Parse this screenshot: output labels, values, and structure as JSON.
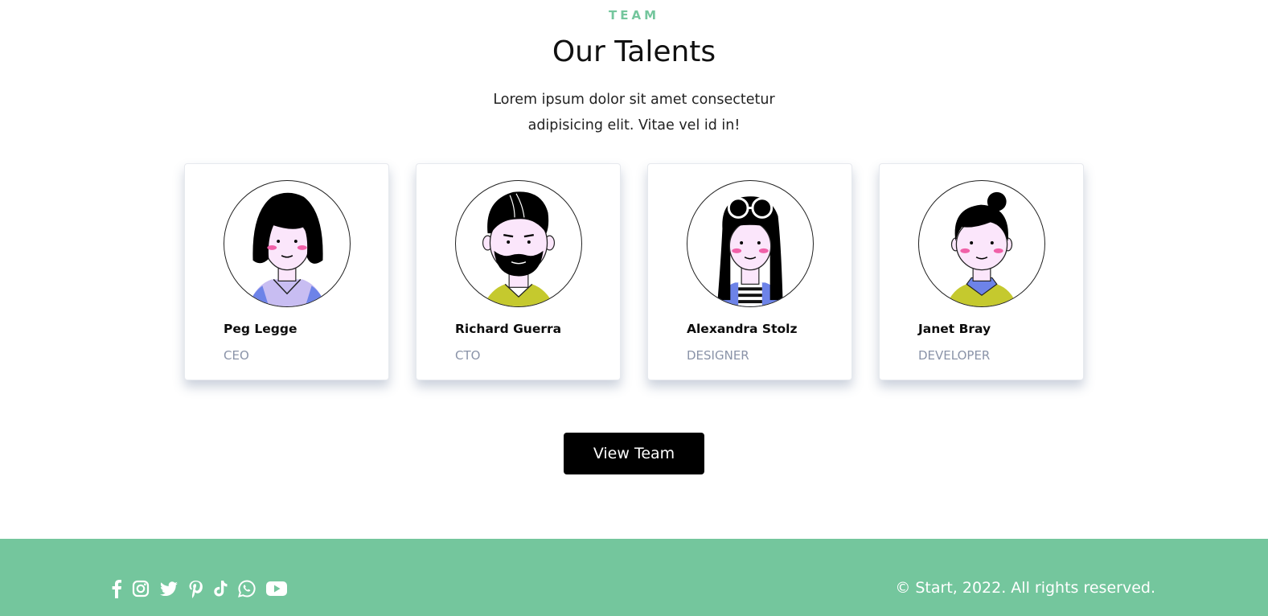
{
  "section": {
    "eyebrow": "TEAM",
    "title": "Our Talents",
    "subtitle_line1": "Lorem ipsum dolor sit amet consectetur",
    "subtitle_line2": "adipisicing elit. Vitae vel id in!"
  },
  "members": [
    {
      "name": "Peg Legge",
      "role": "CEO"
    },
    {
      "name": "Richard Guerra",
      "role": "CTO"
    },
    {
      "name": "Alexandra Stolz",
      "role": "DESIGNER"
    },
    {
      "name": "Janet Bray",
      "role": "DEVELOPER"
    }
  ],
  "cta": {
    "label": "View Team"
  },
  "footer": {
    "social_icons": [
      "facebook-icon",
      "instagram-icon",
      "twitter-icon",
      "pinterest-icon",
      "tiktok-icon",
      "whatsapp-icon",
      "youtube-icon"
    ],
    "copyright": "© Start, 2022. All rights reserved."
  },
  "colors": {
    "accent": "#74c69d",
    "role_text": "#8a93a8",
    "button_bg": "#000000"
  }
}
